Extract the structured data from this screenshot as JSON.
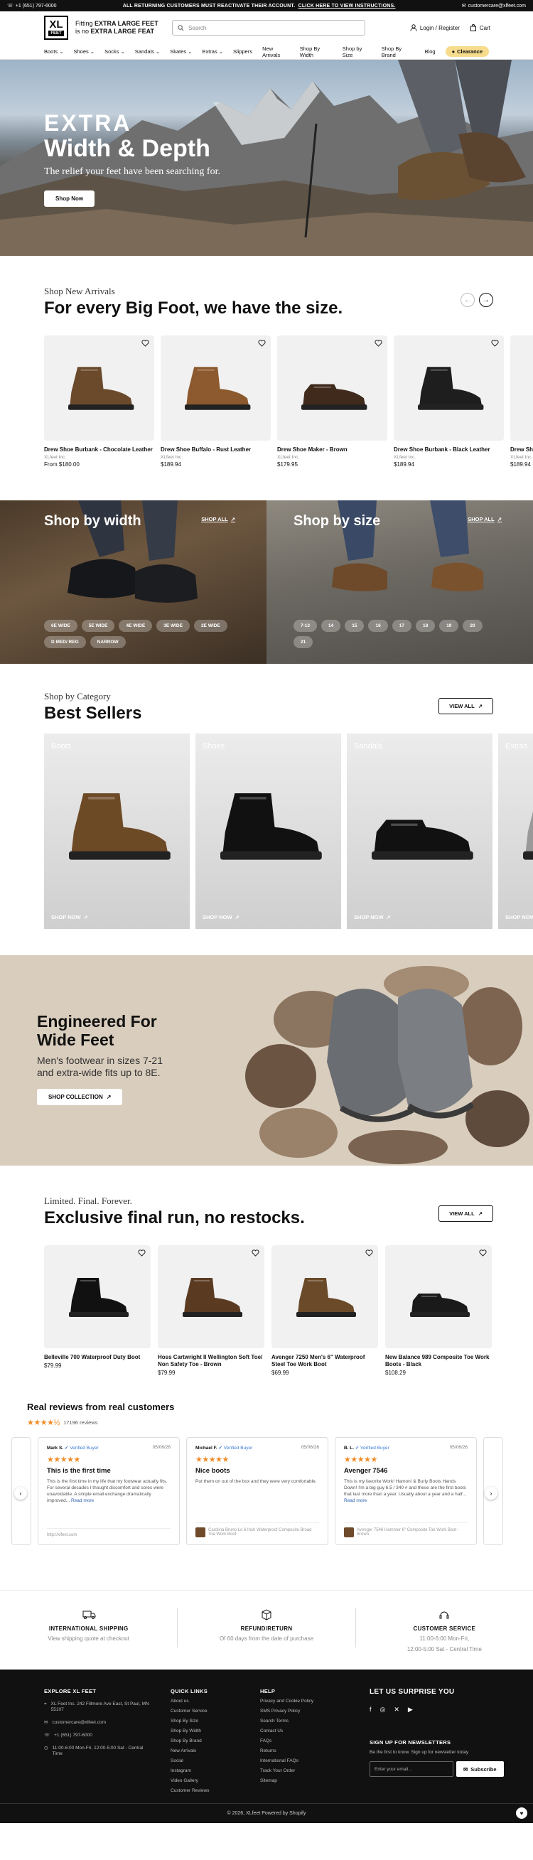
{
  "topbar": {
    "phone": "+1 (651) 797-6000",
    "notice": "ALL RETURNING CUSTOMERS MUST REACTIVATE THEIR ACCOUNT.",
    "notice_link": "CLICK HERE TO VIEW INSTRUCTIONS.",
    "email": "customercare@xlfeet.com"
  },
  "header": {
    "logo_xl": "XL",
    "logo_feet": "FEET",
    "tagline_1": "Fitting ",
    "tagline_1b": "EXTRA LARGE FEET",
    "tagline_2": "is no ",
    "tagline_2b": "EXTRA LARGE FEAT",
    "search_placeholder": "Search",
    "login": "Login / Register",
    "cart": "Cart"
  },
  "nav": {
    "items": [
      {
        "label": "Boots",
        "dd": true
      },
      {
        "label": "Shoes",
        "dd": true
      },
      {
        "label": "Socks",
        "dd": true
      },
      {
        "label": "Sandals",
        "dd": true
      },
      {
        "label": "Skates",
        "dd": true
      },
      {
        "label": "Extras",
        "dd": true
      },
      {
        "label": "Slippers",
        "dd": false
      },
      {
        "label": "New Arrivals",
        "dd": false
      },
      {
        "label": "Shop By Width",
        "dd": false
      },
      {
        "label": "Shop by Size",
        "dd": false
      },
      {
        "label": "Shop By Brand",
        "dd": false
      },
      {
        "label": "Blog",
        "dd": false
      }
    ],
    "clearance": "Clearance"
  },
  "hero": {
    "line1": "EXTRA",
    "line2": "Width & Depth",
    "sub": "The relief your feet have been searching for.",
    "cta": "Shop Now"
  },
  "arrivals": {
    "sub": "Shop New Arrivals",
    "title": "For every Big Foot, we have the size.",
    "products": [
      {
        "name": "Drew Shoe Burbank - Chocolate Leather",
        "brand": "XLfeet Inc.",
        "price": "From $180.00",
        "color": "#6b4a2c"
      },
      {
        "name": "Drew Shoe Buffalo - Rust Leather",
        "brand": "XLfeet Inc.",
        "price": "$189.94",
        "color": "#8c5a2e"
      },
      {
        "name": "Drew Shoe Maker - Brown",
        "brand": "XLfeet Inc.",
        "price": "$179.95",
        "color": "#3f2a1c"
      },
      {
        "name": "Drew Shoe Burbank - Black Leather",
        "brand": "XLfeet Inc.",
        "price": "$189.94",
        "color": "#1e1e1e"
      },
      {
        "name": "Drew Sh",
        "brand": "XLfeet Inc.",
        "price": "$189.94",
        "color": "#2a2a2a"
      }
    ]
  },
  "shopby": {
    "width_title": "Shop by width",
    "size_title": "Shop by size",
    "shop_all": "SHOP ALL",
    "widths": [
      "6E WIDE",
      "5E WIDE",
      "4E WIDE",
      "3E WIDE",
      "2E WIDE",
      "D MED/ REG",
      "NARROW"
    ],
    "sizes": [
      "7-13",
      "14",
      "15",
      "16",
      "17",
      "18",
      "19",
      "20",
      "21"
    ]
  },
  "best": {
    "sub": "Shop by Category",
    "title": "Best Sellers",
    "view_all": "VIEW ALL",
    "cats": [
      {
        "label": "Boots",
        "cta": "SHOP NOW"
      },
      {
        "label": "Shoes",
        "cta": "SHOP NOW"
      },
      {
        "label": "Sandals",
        "cta": "SHOP NOW"
      },
      {
        "label": "Extras",
        "cta": "SHOP NOW"
      }
    ]
  },
  "engineered": {
    "title_1": "Engineered For",
    "title_2": "Wide Feet",
    "desc_1": "Men's footwear in sizes 7-21",
    "desc_2": "and extra-wide fits up to 8E.",
    "cta": "SHOP COLLECTION"
  },
  "final": {
    "sub": "Limited. Final. Forever.",
    "title": "Exclusive final run, no restocks.",
    "view_all": "VIEW ALL",
    "products": [
      {
        "name": "Belleville 700 Waterproof Duty Boot",
        "price": "$79.99"
      },
      {
        "name": "Hoss Cartwright II Wellington Soft Toe/ Non Safety Toe - Brown",
        "price": "$79.99"
      },
      {
        "name": "Avenger 7250 Men's 6\" Waterproof Steel Toe Work Boot",
        "price": "$69.99"
      },
      {
        "name": "New Balance 989 Composite Toe Work Boots - Black",
        "price": "$108.29"
      }
    ]
  },
  "reviews": {
    "title": "Real reviews from real customers",
    "stars": "★★★★½",
    "count": "17196 reviews",
    "items": [
      {
        "name": "Mark S.",
        "verified": "Verified Buyer",
        "date": "05/06/26",
        "stars": "★★★★★",
        "title": "This is the first time",
        "body": "This is the first time in my life that my footwear actually fits. For several decades I thought discomfort and sores were unavoidable. A simple email exchange dramatically improved...",
        "more": "Read more",
        "product": "http://xlfeet.com"
      },
      {
        "name": "Michael F.",
        "verified": "Verified Buyer",
        "date": "05/06/26",
        "stars": "★★★★★",
        "title": "Nice boots",
        "body": "Put them on out of the box and they were very comfortable.",
        "more": "",
        "product": "Carolina Bruno Lo 6 Inch Waterproof Composite Broad Toe Work Boot"
      },
      {
        "name": "B. L.",
        "verified": "Verified Buyer",
        "date": "05/06/26",
        "stars": "★★★★★",
        "title": "Avenger 7546",
        "body": "This is my favorite Work! Hamon! & Burly Boots Hands Down! I'm a big guy 6.5 / 340 # and these are the first boots that last more than a year. Usually about a year and a half...",
        "more": "Read more",
        "product": "Avenger 7546 Hammer 6\" Composite Toe Work Boot - Brown"
      }
    ]
  },
  "features": [
    {
      "title": "INTERNATIONAL SHIPPING",
      "sub": "View shipping quote at checkout",
      "icon": "truck-icon"
    },
    {
      "title": "REFUND/RETURN",
      "sub": "Of 60 days from the date of purchase",
      "icon": "box-icon"
    },
    {
      "title": "CUSTOMER SERVICE",
      "sub": "11:00-6:00 Mon-Fri,",
      "sub2": "12:00-5:00 Sat - Central Time",
      "icon": "headset-icon"
    }
  ],
  "footer": {
    "explore": "EXPLORE XL FEET",
    "address": "XL Feet Inc. 242 Fillmore Ave East, St Paul, MN 55107",
    "email": "customercare@xlfeet.com",
    "phone": "+1 (651) 797-6000",
    "hours": "11:00-6:00 Mon-Fri, 12:00-5:00 Sat - Central Time",
    "quick_title": "QUICK LINKS",
    "quick": [
      "About us",
      "Customer Service",
      "Shop By Size",
      "Shop By Width",
      "Shop By Brand",
      "New Arrivals",
      "Social",
      "Instagram",
      "Video Gallery",
      "Customer Reviews"
    ],
    "help_title": "HELP",
    "help": [
      "Privacy and Cookie Policy",
      "SMS Privacy Policy",
      "Search Terms",
      "Contact Us",
      "FAQs",
      "Returns",
      "International FAQs",
      "Track Your Order",
      "Sitemap"
    ],
    "surprise": "LET US SURPRISE YOU",
    "signup_title": "SIGN UP FOR NEWSLETTERS",
    "signup_sub": "Be the first to know. Sign up for newsletter today",
    "email_placeholder": "Enter your email...",
    "subscribe": "Subscribe",
    "copyright": "© 2026, XLfeet Powered by Shopify"
  }
}
